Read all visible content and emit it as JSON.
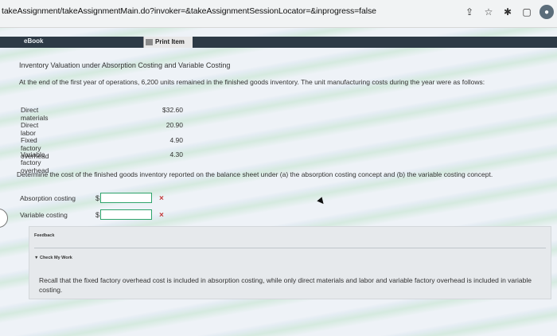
{
  "browser": {
    "url": "takeAssignment/takeAssignmentMain.do?invoker=&takeAssignmentSessionLocator=&inprogress=false",
    "icons": [
      "share-icon",
      "star-icon",
      "extensions-icon",
      "window-icon",
      "profile-icon"
    ]
  },
  "tabs": {
    "ebook": "eBook",
    "print_item": "Print Item"
  },
  "problem": {
    "title": "Inventory Valuation under Absorption Costing and Variable Costing",
    "intro": "At the end of the first year of operations, 6,200 units remained in the finished goods inventory. The unit manufacturing costs during the year were as follows:",
    "costs": [
      {
        "label": "Direct materials",
        "value": "$32.60"
      },
      {
        "label": "Direct labor",
        "value": "20.90"
      },
      {
        "label": "Fixed factory overhead",
        "value": "4.90"
      },
      {
        "label": "Variable factory overhead",
        "value": "4.30"
      }
    ],
    "question": "Determine the cost of the finished goods inventory reported on the balance sheet under (a) the absorption costing concept and (b) the variable costing concept."
  },
  "answers": [
    {
      "label": "Absorption costing",
      "currency": "$",
      "value": "",
      "status": "×"
    },
    {
      "label": "Variable costing",
      "currency": "$",
      "value": "",
      "status": "×"
    }
  ],
  "feedback": {
    "title": "Feedback",
    "check_label": "▼ Check My Work",
    "text": "Recall that the fixed factory overhead cost is included in absorption costing, while only direct materials and labor and variable factory overhead is included in variable costing."
  },
  "nav": {
    "prev_icon": "‹"
  }
}
